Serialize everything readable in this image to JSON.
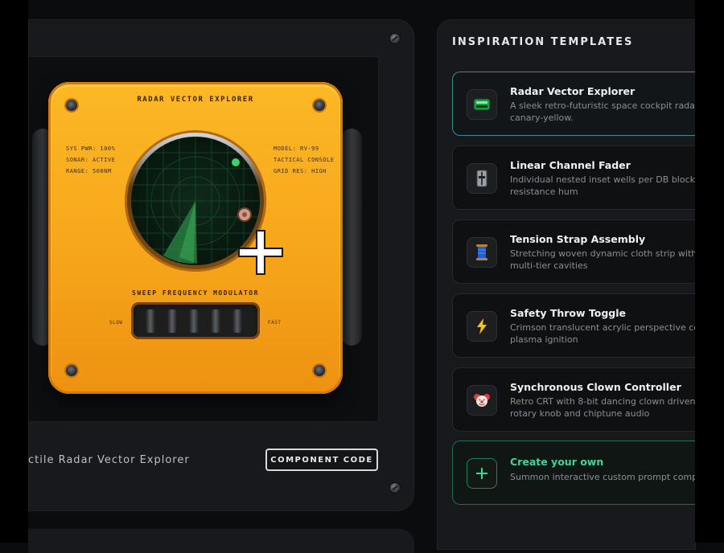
{
  "device": {
    "title": "RADAR VECTOR EXPLORER",
    "readout_left": [
      "SYS PWR: 100%",
      "SONAR: ACTIVE",
      "RANGE: 500NM"
    ],
    "readout_right": [
      "MODEL: RV-99",
      "TACTICAL CONSOLE",
      "GRID RES: HIGH"
    ],
    "modulator_label": "SWEEP FREQUENCY MODULATOR",
    "slow_label": "SLOW",
    "fast_label": "FAST"
  },
  "stage": {
    "caption": "ctile Radar Vector Explorer",
    "code_button": "COMPONENT CODE"
  },
  "panel": {
    "title": "INSPIRATION TEMPLATES",
    "templates": [
      {
        "name": "Radar Vector Explorer",
        "desc": "A sleek retro-futuristic space cockpit rada\ncanary-yellow.",
        "icon": "radar-icon"
      },
      {
        "name": "Linear Channel Fader",
        "desc": "Individual nested inset wells per DB block\nresistance hum",
        "icon": "fader-icon"
      },
      {
        "name": "Tension Strap Assembly",
        "desc": "Stretching woven dynamic cloth strip with\nmulti-tier cavities",
        "icon": "spool-icon"
      },
      {
        "name": "Safety Throw Toggle",
        "desc": "Crimson translucent acrylic perspective co\nplasma ignition",
        "icon": "lightning-icon"
      },
      {
        "name": "Synchronous Clown Controller",
        "desc": "Retro CRT with 8-bit dancing clown driven\nrotary knob and chiptune audio",
        "icon": "clown-icon"
      }
    ],
    "create": {
      "name": "Create your own",
      "desc": "Summon interactive custom prompt compi",
      "icon": "plus-icon"
    }
  },
  "colors": {
    "accent_teal": "#3d8c8c",
    "accent_green": "#3fd69a",
    "device_yellow": "#f6a61a"
  }
}
